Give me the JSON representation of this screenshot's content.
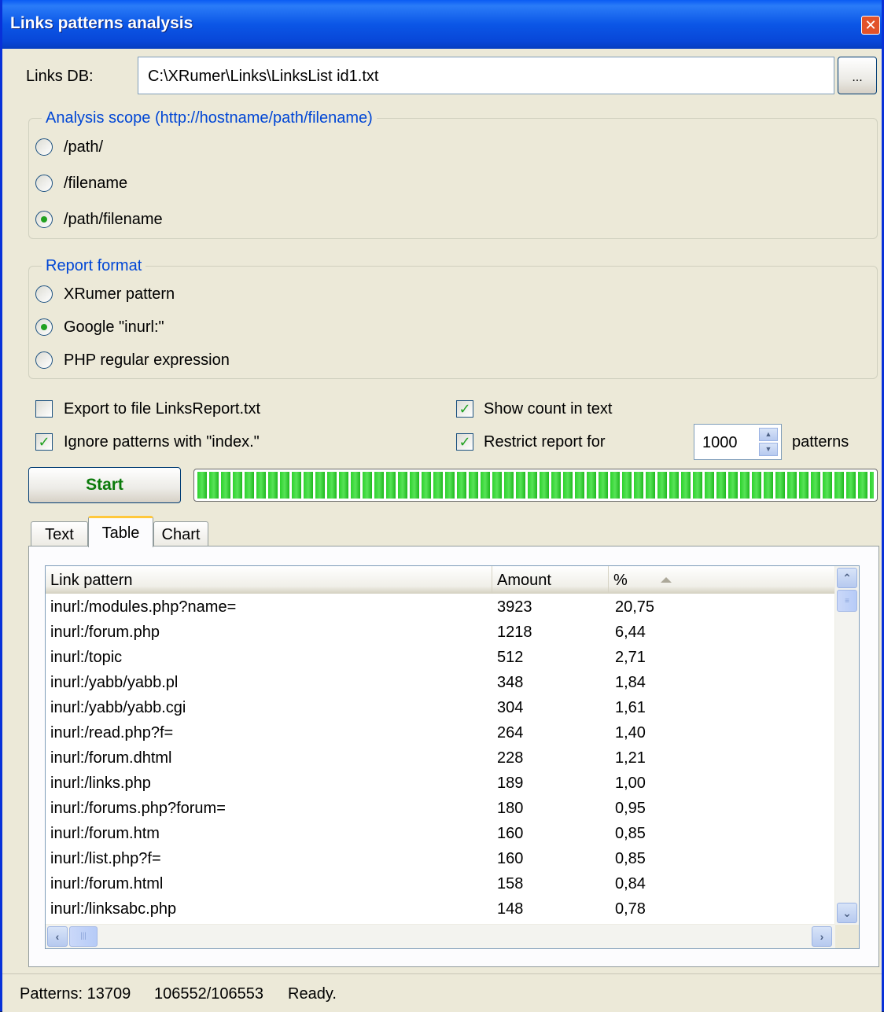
{
  "window": {
    "title": "Links patterns analysis",
    "close_glyph": "✕"
  },
  "links_db": {
    "label": "Links DB:",
    "value": "C:\\XRumer\\Links\\LinksList id1.txt",
    "browse_label": "..."
  },
  "analysis_scope": {
    "legend": "Analysis scope (http://hostname/path/filename)",
    "options": [
      {
        "label": "/path/",
        "checked": false
      },
      {
        "label": "/filename",
        "checked": false
      },
      {
        "label": "/path/filename",
        "checked": true
      }
    ]
  },
  "report_format": {
    "legend": "Report format",
    "options": [
      {
        "label": "XRumer pattern",
        "checked": false
      },
      {
        "label": "Google \"inurl:\"",
        "checked": true
      },
      {
        "label": "PHP regular expression",
        "checked": false
      }
    ]
  },
  "options": {
    "export_to_file": {
      "label": "Export to file LinksReport.txt",
      "checked": false
    },
    "ignore_index": {
      "label": "Ignore patterns with \"index.\"",
      "checked": true
    },
    "show_count": {
      "label": "Show count in text",
      "checked": true
    },
    "restrict_report": {
      "label": "Restrict report for",
      "checked": true,
      "value": "1000",
      "suffix": "patterns"
    },
    "check_glyph": "✓"
  },
  "start_button": {
    "label": "Start"
  },
  "progress": {
    "percent": 100
  },
  "tabs": [
    {
      "label": "Text",
      "active": false
    },
    {
      "label": "Table",
      "active": true
    },
    {
      "label": "Chart",
      "active": false
    }
  ],
  "table": {
    "columns": [
      "Link pattern",
      "Amount",
      "%"
    ],
    "rows": [
      [
        "inurl:/modules.php?name=",
        "3923",
        "20,75"
      ],
      [
        "inurl:/forum.php",
        "1218",
        "6,44"
      ],
      [
        "inurl:/topic",
        "512",
        "2,71"
      ],
      [
        "inurl:/yabb/yabb.pl",
        "348",
        "1,84"
      ],
      [
        "inurl:/yabb/yabb.cgi",
        "304",
        "1,61"
      ],
      [
        "inurl:/read.php?f=",
        "264",
        "1,40"
      ],
      [
        "inurl:/forum.dhtml",
        "228",
        "1,21"
      ],
      [
        "inurl:/links.php",
        "189",
        "1,00"
      ],
      [
        "inurl:/forums.php?forum=",
        "180",
        "0,95"
      ],
      [
        "inurl:/forum.htm",
        "160",
        "0,85"
      ],
      [
        "inurl:/list.php?f=",
        "160",
        "0,85"
      ],
      [
        "inurl:/forum.html",
        "158",
        "0,84"
      ],
      [
        "inurl:/linksabc.php",
        "148",
        "0,78"
      ]
    ]
  },
  "statusbar": {
    "patterns": "Patterns: 13709",
    "progress": "106552/106553",
    "state": "Ready."
  }
}
